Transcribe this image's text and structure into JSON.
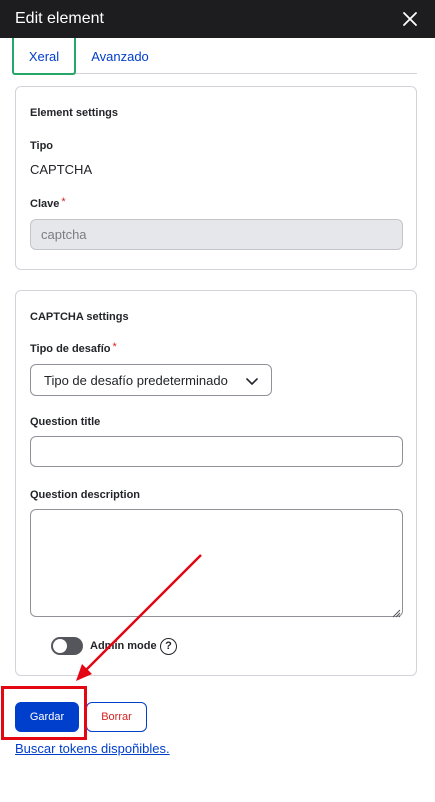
{
  "dialog": {
    "title": "Edit element",
    "close_icon": "close-icon"
  },
  "tabs": [
    {
      "label": "Xeral",
      "active": true
    },
    {
      "label": "Avanzado",
      "active": false
    }
  ],
  "element_settings": {
    "legend": "Element settings",
    "tipo_label": "Tipo",
    "tipo_value": "CAPTCHA",
    "clave_label": "Clave",
    "required_mark": "*",
    "clave_value": "captcha"
  },
  "captcha_settings": {
    "legend": "CAPTCHA settings",
    "challenge_label": "Tipo de desafío",
    "required_mark": "*",
    "challenge_selected": "Tipo de desafío predeterminado",
    "question_title_label": "Question title",
    "question_title_value": "",
    "question_description_label": "Question description",
    "question_description_value": "",
    "admin_mode_label": "Admin mode",
    "admin_mode_on": false,
    "help_glyph": "?"
  },
  "actions": {
    "save_label": "Gardar",
    "delete_label": "Borrar",
    "tokens_link": "Buscar tokens dispoñibles."
  },
  "colors": {
    "header_bg": "#1d1d1f",
    "primary": "#003ecc",
    "danger": "#d72222",
    "active_tab_border": "#26a769",
    "annotation": "#e30613"
  }
}
